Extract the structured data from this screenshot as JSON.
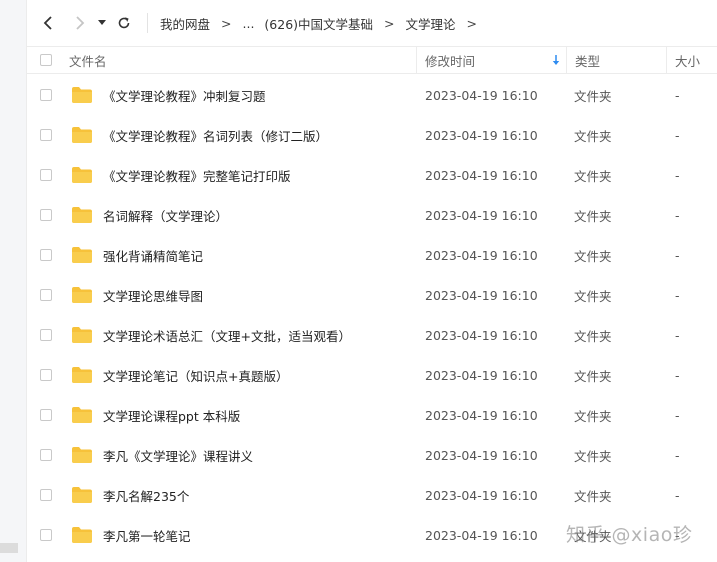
{
  "toolbar": {
    "breadcrumb": [
      "我的网盘",
      "...",
      "(626)中国文学基础",
      "文学理论"
    ],
    "separator": ">"
  },
  "columns": {
    "name": "文件名",
    "modified": "修改时间",
    "type": "类型",
    "size": "大小"
  },
  "sort": {
    "column": "modified",
    "direction": "descending"
  },
  "files": [
    {
      "name": "《文学理论教程》冲刺复习题",
      "modified": "2023-04-19 16:10",
      "type": "文件夹",
      "size": "-"
    },
    {
      "name": "《文学理论教程》名词列表（修订二版）",
      "modified": "2023-04-19 16:10",
      "type": "文件夹",
      "size": "-"
    },
    {
      "name": "《文学理论教程》完整笔记打印版",
      "modified": "2023-04-19 16:10",
      "type": "文件夹",
      "size": "-"
    },
    {
      "name": "名词解释（文学理论）",
      "modified": "2023-04-19 16:10",
      "type": "文件夹",
      "size": "-"
    },
    {
      "name": "强化背诵精简笔记",
      "modified": "2023-04-19 16:10",
      "type": "文件夹",
      "size": "-"
    },
    {
      "name": "文学理论思维导图",
      "modified": "2023-04-19 16:10",
      "type": "文件夹",
      "size": "-"
    },
    {
      "name": "文学理论术语总汇（文理+文批，适当观看）",
      "modified": "2023-04-19 16:10",
      "type": "文件夹",
      "size": "-"
    },
    {
      "name": "文学理论笔记（知识点+真题版）",
      "modified": "2023-04-19 16:10",
      "type": "文件夹",
      "size": "-"
    },
    {
      "name": "文学理论课程ppt 本科版",
      "modified": "2023-04-19 16:10",
      "type": "文件夹",
      "size": "-"
    },
    {
      "name": "李凡《文学理论》课程讲义",
      "modified": "2023-04-19 16:10",
      "type": "文件夹",
      "size": "-"
    },
    {
      "name": "李凡名解235个",
      "modified": "2023-04-19 16:10",
      "type": "文件夹",
      "size": "-"
    },
    {
      "name": "李凡第一轮笔记",
      "modified": "2023-04-19 16:10",
      "type": "文件夹",
      "size": "-"
    }
  ],
  "watermark": "知乎 @xiao珍",
  "colors": {
    "folder": "#f7c23a",
    "accent": "#2f8cf0"
  }
}
